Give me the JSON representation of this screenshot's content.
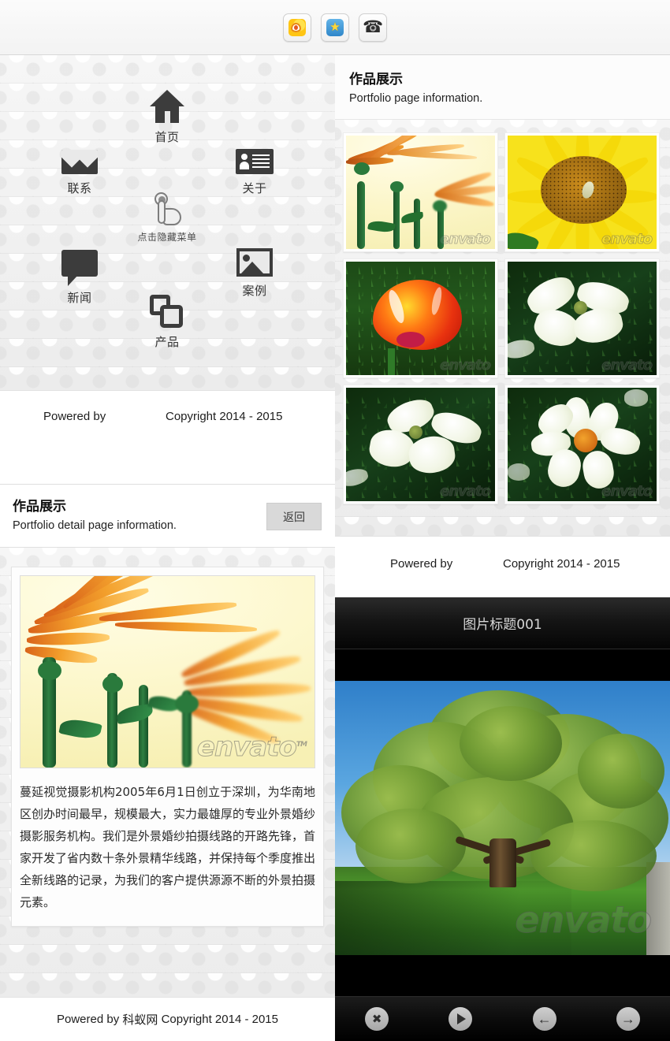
{
  "topbar": {
    "buttons": [
      {
        "name": "weibo",
        "label": "新浪微博",
        "icon": "weibo-icon"
      },
      {
        "name": "favorite",
        "label": "收藏",
        "icon": "star-icon"
      },
      {
        "name": "phone",
        "label": "电话",
        "icon": "phone-icon"
      }
    ]
  },
  "menu": {
    "items": [
      {
        "id": "home",
        "label": "首页",
        "icon": "home-icon"
      },
      {
        "id": "contact",
        "label": "联系",
        "icon": "mail-icon"
      },
      {
        "id": "about",
        "label": "关于",
        "icon": "id-card-icon"
      },
      {
        "id": "news",
        "label": "新闻",
        "icon": "speech-bubble-icon"
      },
      {
        "id": "case",
        "label": "案例",
        "icon": "image-icon"
      },
      {
        "id": "product",
        "label": "产品",
        "icon": "layers-icon"
      },
      {
        "id": "toggle",
        "label": "点击隐藏菜单",
        "icon": "tap-hand-icon"
      }
    ]
  },
  "footer_left": {
    "powered_by": "Powered by",
    "copyright": "Copyright 2014 - 2015"
  },
  "detail": {
    "title": "作品展示",
    "subtitle": "Portfolio detail page information.",
    "back_label": "返回",
    "body": "蔓延视觉摄影机构2005年6月1日创立于深圳，为华南地区创办时间最早，规模最大，实力最雄厚的专业外景婚纱摄影服务机构。我们是外景婚纱拍摄线路的开路先锋，首家开发了省内数十条外景精华线路，并保持每个季度推出全新线路的记录，为我们的客户提供源源不断的外景拍摄元素。",
    "image_watermark": "envato"
  },
  "bottom_credit": {
    "prefix": "Powered by",
    "site": "科蚁网",
    "suffix": "Copyright 2014 - 2015"
  },
  "portfolio": {
    "title": "作品展示",
    "subtitle": "Portfolio page information.",
    "thumbnails": [
      {
        "id": 1,
        "alt": "橙色雏菊",
        "watermark": "envato"
      },
      {
        "id": 2,
        "alt": "向日葵与蜜蜂",
        "watermark": "envato"
      },
      {
        "id": 3,
        "alt": "红色郁金香",
        "watermark": "envato"
      },
      {
        "id": 4,
        "alt": "白色山茱萸花",
        "watermark": "envato"
      },
      {
        "id": 5,
        "alt": "白色山茱萸花",
        "watermark": "envato"
      },
      {
        "id": 6,
        "alt": "白色花朵橙心",
        "watermark": "envato"
      }
    ]
  },
  "footer_right": {
    "powered_by": "Powered by",
    "copyright": "Copyright 2014 - 2015"
  },
  "lightbox": {
    "title": "图片标题001",
    "image_alt": "大树与草地",
    "image_watermark": "envato",
    "controls": [
      {
        "id": "close",
        "label": "关闭",
        "icon": "close-icon"
      },
      {
        "id": "play",
        "label": "播放",
        "icon": "play-icon"
      },
      {
        "id": "prev",
        "label": "上一张",
        "icon": "arrow-left-icon"
      },
      {
        "id": "next",
        "label": "下一张",
        "icon": "arrow-right-icon"
      }
    ]
  },
  "colors": {
    "icon_dark": "#3c3c3c",
    "panel_bg": "#f2f2f2",
    "back_button": "#d9d9d9",
    "lightbox_bg": "#000000"
  }
}
